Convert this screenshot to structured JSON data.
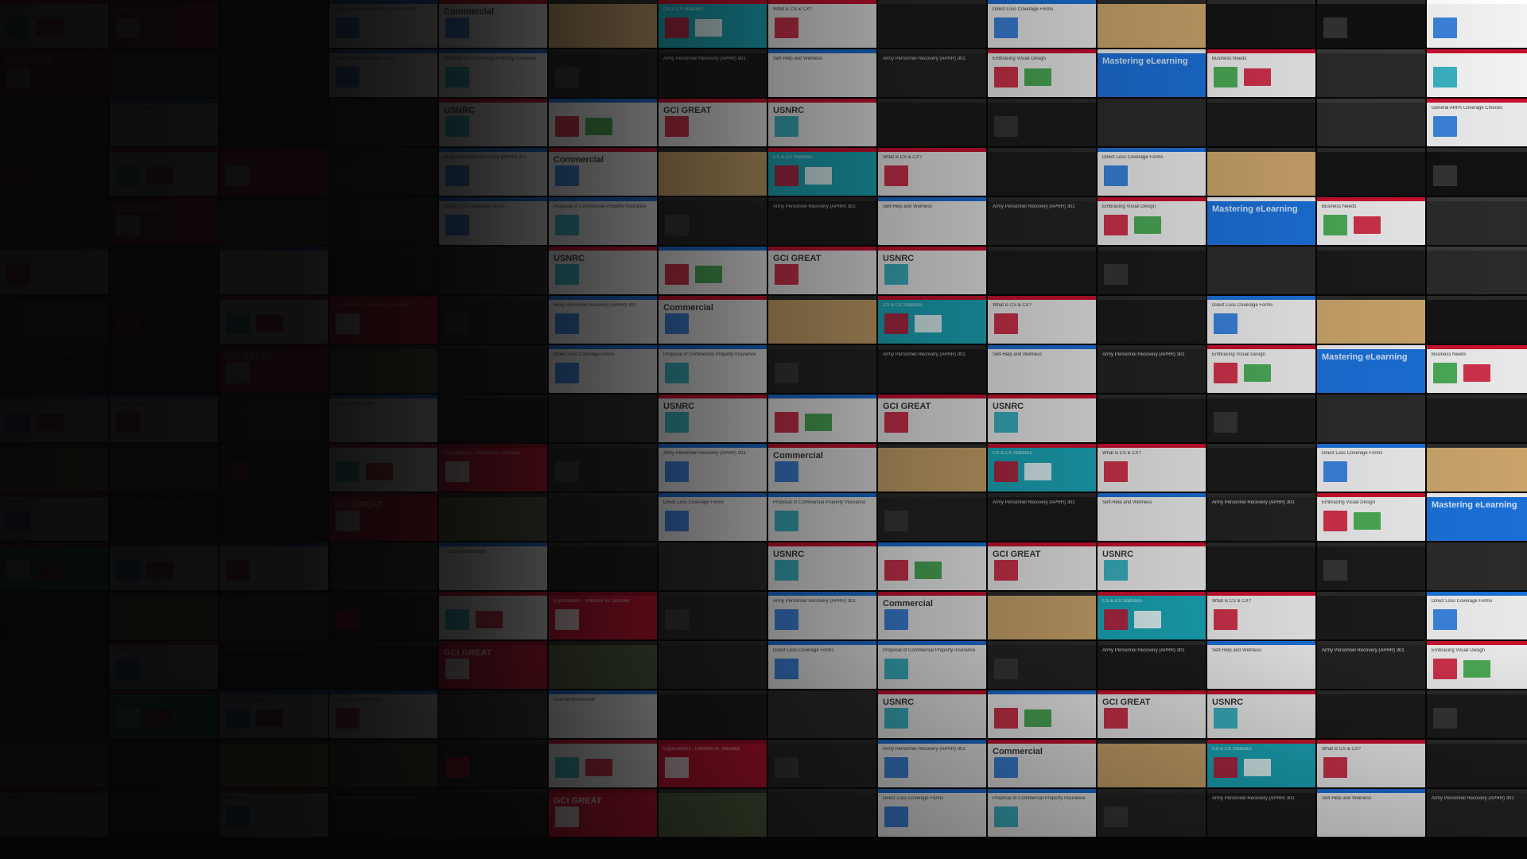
{
  "palette": {
    "background": "#050505",
    "tile_dark": "#1a1a1a",
    "tile_mid": "#3a3a3a",
    "accent_red": "#c8102e",
    "accent_blue": "#1b6fd6",
    "accent_teal": "#1aa6b7",
    "paper": "#e9e9e9",
    "sand": "#c9a36a",
    "olive": "#4d5a3a"
  },
  "tiles": [
    {
      "bg": "#e9e9e9",
      "bar": "#c8102e",
      "text": "",
      "big": false,
      "blocks": [
        "#1aa6b7",
        "#c8102e"
      ]
    },
    {
      "bg": "#222222",
      "bar": "#2a2a2a",
      "text": "Army Personnel Recovery (APRR) 301",
      "big": false,
      "blocks": []
    },
    {
      "bg": "#e9e9e9",
      "bar": "#c8102e",
      "text": "Summary",
      "big": false,
      "blocks": [
        "#1b6fd6"
      ]
    },
    {
      "bg": "#f2f2f2",
      "bar": "#1b6fd6",
      "text": "",
      "big": false,
      "blocks": [
        "#c8102e",
        "#2e9d3b"
      ]
    },
    {
      "bg": "#111111",
      "bar": "#2a2a2a",
      "text": "",
      "big": false,
      "blocks": [
        "#3a3a3a"
      ]
    },
    {
      "bg": "#c8102e",
      "bar": "#a00a22",
      "text": "Expectations - Effective vs. Decided",
      "big": false,
      "blocks": [
        "#e9e9e9"
      ]
    },
    {
      "bg": "#e9e9e9",
      "bar": "#c8102e",
      "text": "Embracing Visual Design",
      "big": false,
      "blocks": [
        "#c8102e",
        "#2e9d3b"
      ]
    },
    {
      "bg": "#1a1a1a",
      "bar": "#2a2a2a",
      "text": "Army Personnel Recovery (APRR) 301",
      "big": false,
      "blocks": []
    },
    {
      "bg": "#e9e9e9",
      "bar": "#c8102e",
      "text": "GCI GREAT",
      "big": true,
      "blocks": [
        "#c8102e"
      ]
    },
    {
      "bg": "#f2f2f2",
      "bar": "#ffffff",
      "text": "",
      "big": false,
      "blocks": [
        "#1b6fd6"
      ]
    },
    {
      "bg": "#222222",
      "bar": "#2a2a2a",
      "text": "",
      "big": false,
      "blocks": [
        "#3a3a3a"
      ]
    },
    {
      "bg": "#1b6fd6",
      "bar": "#e9e9e9",
      "text": "Mastering eLearning",
      "big": true,
      "blocks": []
    },
    {
      "bg": "#141414",
      "bar": "#2a2a2a",
      "text": "",
      "big": false,
      "blocks": []
    },
    {
      "bg": "#e9e9e9",
      "bar": "#c8102e",
      "text": "USNRC",
      "big": true,
      "blocks": [
        "#1aa6b7"
      ]
    },
    {
      "bg": "#1a1a1a",
      "bar": "#2a2a2a",
      "text": "",
      "big": false,
      "blocks": [
        "#3a3a3a"
      ]
    },
    {
      "bg": "#e9e9e9",
      "bar": "#1b6fd6",
      "text": "Army Personnel Recovery (APRR) 301",
      "big": false,
      "blocks": [
        "#1b6fd6"
      ]
    },
    {
      "bg": "#e9e9e9",
      "bar": "#c8102e",
      "text": "Business Needs",
      "big": false,
      "blocks": [
        "#2e9d3b",
        "#c8102e"
      ]
    },
    {
      "bg": "#c8102e",
      "bar": "#a00a22",
      "text": "GCI GREAT",
      "big": true,
      "blocks": [
        "#e9e9e9"
      ]
    },
    {
      "bg": "#1a1a1a",
      "bar": "#2a2a2a",
      "text": "",
      "big": false,
      "blocks": []
    },
    {
      "bg": "#1aa6b7",
      "bar": "#c8102e",
      "text": "CS & CX Statistics",
      "big": false,
      "blocks": [
        "#ffffff",
        "#c8102e"
      ]
    },
    {
      "bg": "#e9e9e9",
      "bar": "#c8102e",
      "text": "Commercial",
      "big": true,
      "blocks": [
        "#1b6fd6"
      ]
    },
    {
      "bg": "#2a2a2a",
      "bar": "#3a3a3a",
      "text": "",
      "big": false,
      "blocks": []
    },
    {
      "bg": "#4d5a3a",
      "bar": "#2a2a2a",
      "text": "",
      "big": false,
      "blocks": []
    },
    {
      "bg": "#1a1a1a",
      "bar": "#2a2a2a",
      "text": "",
      "big": false,
      "blocks": [
        "#3a3a3a"
      ]
    },
    {
      "bg": "#e9e9e9",
      "bar": "#1b6fd6",
      "text": "What You've Learned",
      "big": false,
      "blocks": [
        "#1b6fd6",
        "#c8102e"
      ]
    },
    {
      "bg": "#c9a36a",
      "bar": "#2a2a2a",
      "text": "",
      "big": false,
      "blocks": []
    },
    {
      "bg": "#f2f2f2",
      "bar": "#c8102e",
      "text": "",
      "big": false,
      "blocks": [
        "#1aa6b7"
      ]
    },
    {
      "bg": "#222222",
      "bar": "#2a2a2a",
      "text": "",
      "big": false,
      "blocks": []
    },
    {
      "bg": "#2a2a2a",
      "bar": "#2a2a2a",
      "text": "",
      "big": false,
      "blocks": []
    },
    {
      "bg": "#e9e9e9",
      "bar": "#1b6fd6",
      "text": "Needs & Expectations",
      "big": false,
      "blocks": [
        "#c8102e"
      ]
    },
    {
      "bg": "#1aa6b7",
      "bar": "#c8102e",
      "text": "CS & CX Statistics",
      "big": false,
      "blocks": [
        "#c8102e",
        "#ffffff"
      ]
    },
    {
      "bg": "#c9a36a",
      "bar": "#2a2a2a",
      "text": "Army Personnel Recovery (APRR) 301",
      "big": false,
      "blocks": []
    },
    {
      "bg": "#e9e9e9",
      "bar": "#1b6fd6",
      "text": "Direct Loss Coverage Forms",
      "big": false,
      "blocks": [
        "#1b6fd6"
      ]
    },
    {
      "bg": "#1a1a1a",
      "bar": "#2a2a2a",
      "text": "",
      "big": false,
      "blocks": []
    },
    {
      "bg": "#3a3a3a",
      "bar": "#2a2a2a",
      "text": "",
      "big": false,
      "blocks": []
    },
    {
      "bg": "#e9e9e9",
      "bar": "#c8102e",
      "text": "What is CS & CX?",
      "big": false,
      "blocks": [
        "#c8102e"
      ]
    },
    {
      "bg": "#141414",
      "bar": "#2a2a2a",
      "text": "Army Personnel Recovery (APRR) 301",
      "big": false,
      "blocks": []
    },
    {
      "bg": "#e9e9e9",
      "bar": "#1b6fd6",
      "text": "Proposal of Commercial Property Insurance",
      "big": false,
      "blocks": [
        "#1aa6b7"
      ]
    },
    {
      "bg": "#2a2a2a",
      "bar": "#3a3a3a",
      "text": "",
      "big": false,
      "blocks": []
    },
    {
      "bg": "#e9e9e9",
      "bar": "#1b6fd6",
      "text": "Course Introduction",
      "big": false,
      "blocks": []
    },
    {
      "bg": "#1a1a1a",
      "bar": "#2a2a2a",
      "text": "",
      "big": false,
      "blocks": []
    },
    {
      "bg": "#c9a36a",
      "bar": "#3a3a3a",
      "text": "",
      "big": false,
      "blocks": []
    },
    {
      "bg": "#222222",
      "bar": "#2a2a2a",
      "text": "",
      "big": false,
      "blocks": [
        "#3a3a3a"
      ]
    },
    {
      "bg": "#e9e9e9",
      "bar": "#c8102e",
      "text": "General ARPs Coverage Choices",
      "big": false,
      "blocks": [
        "#1b6fd6"
      ]
    },
    {
      "bg": "#1a1a1a",
      "bar": "#2a2a2a",
      "text": "",
      "big": false,
      "blocks": []
    },
    {
      "bg": "#e9e9e9",
      "bar": "#1b6fd6",
      "text": "Direct Loss Coverage Forms",
      "big": false,
      "blocks": [
        "#1b6fd6"
      ]
    },
    {
      "bg": "#4d5a3a",
      "bar": "#2a2a2a",
      "text": "",
      "big": false,
      "blocks": []
    },
    {
      "bg": "#1a1a1a",
      "bar": "#2a2a2a",
      "text": "Army Personnel Recovery (APRR) 301",
      "big": false,
      "blocks": []
    },
    {
      "bg": "#e9e9e9",
      "bar": "#c8102e",
      "text": "Summary",
      "big": false,
      "blocks": []
    },
    {
      "bg": "#2a2a2a",
      "bar": "#2a2a2a",
      "text": "",
      "big": false,
      "blocks": []
    },
    {
      "bg": "#c9a36a",
      "bar": "#2a2a2a",
      "text": "",
      "big": false,
      "blocks": []
    },
    {
      "bg": "#1a1a1a",
      "bar": "#2a2a2a",
      "text": "",
      "big": false,
      "blocks": [
        "#c8102e"
      ]
    },
    {
      "bg": "#e9e9e9",
      "bar": "#1b6fd6",
      "text": "Self-Help and Wellness",
      "big": false,
      "blocks": []
    },
    {
      "bg": "#222222",
      "bar": "#2a2a2a",
      "text": "",
      "big": false,
      "blocks": []
    },
    {
      "bg": "#e9e9e9",
      "bar": "#c8102e",
      "text": "USNRC",
      "big": true,
      "blocks": [
        "#1aa6b7"
      ]
    },
    {
      "bg": "#141414",
      "bar": "#2a2a2a",
      "text": "",
      "big": false,
      "blocks": []
    }
  ]
}
